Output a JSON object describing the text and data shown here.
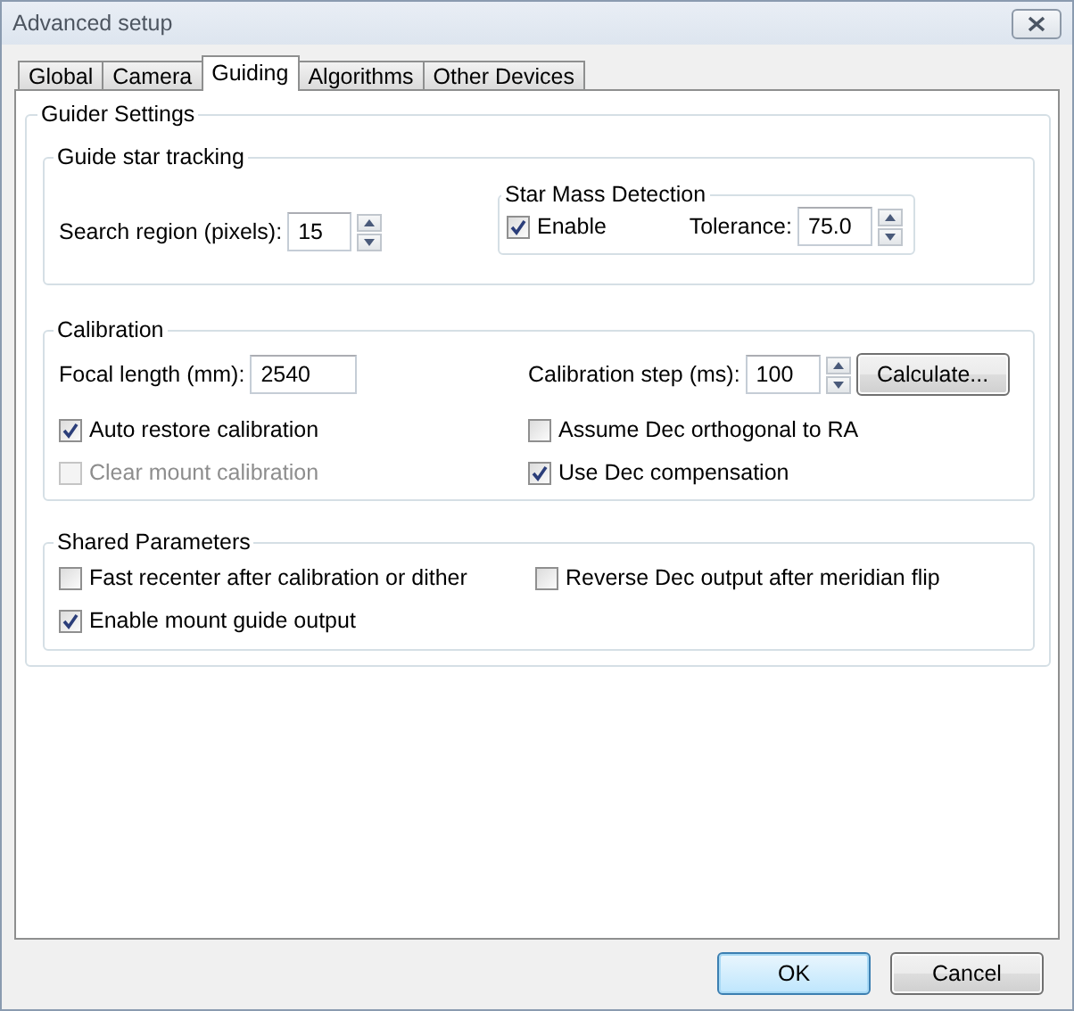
{
  "window": {
    "title": "Advanced setup"
  },
  "tabs": [
    {
      "label": "Global",
      "selected": false
    },
    {
      "label": "Camera",
      "selected": false
    },
    {
      "label": "Guiding",
      "selected": true
    },
    {
      "label": "Algorithms",
      "selected": false
    },
    {
      "label": "Other Devices",
      "selected": false
    }
  ],
  "guider_settings": {
    "title": "Guider Settings",
    "guide_star_tracking": {
      "title": "Guide star tracking",
      "search_region": {
        "label": "Search region (pixels):",
        "value": "15"
      },
      "star_mass_detection": {
        "title": "Star Mass Detection",
        "enable": {
          "label": "Enable",
          "checked": true
        },
        "tolerance": {
          "label": "Tolerance:",
          "value": "75.0"
        }
      }
    },
    "calibration": {
      "title": "Calibration",
      "focal_length": {
        "label": "Focal length (mm):",
        "value": "2540"
      },
      "calibration_step": {
        "label": "Calibration step (ms):",
        "value": "100"
      },
      "calculate_button": "Calculate...",
      "options": [
        {
          "label": "Auto restore calibration",
          "checked": true,
          "disabled": false
        },
        {
          "label": "Assume Dec orthogonal to RA",
          "checked": false,
          "disabled": false
        },
        {
          "label": "Clear mount calibration",
          "checked": false,
          "disabled": true
        },
        {
          "label": "Use Dec compensation",
          "checked": true,
          "disabled": false
        }
      ]
    },
    "shared_parameters": {
      "title": "Shared Parameters",
      "options": [
        {
          "label": "Fast recenter after calibration or dither",
          "checked": false,
          "disabled": false
        },
        {
          "label": "Reverse Dec output after meridian flip",
          "checked": false,
          "disabled": false
        },
        {
          "label": "Enable mount guide output",
          "checked": true,
          "disabled": false
        }
      ]
    }
  },
  "buttons": [
    {
      "label": "OK",
      "default": true
    },
    {
      "label": "Cancel",
      "default": false
    }
  ]
}
